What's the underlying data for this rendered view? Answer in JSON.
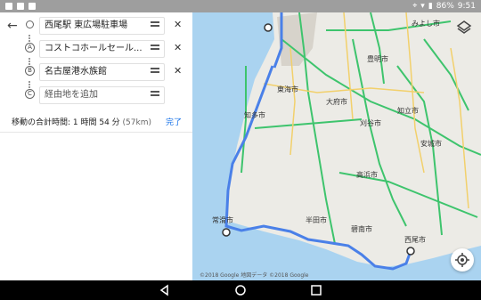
{
  "status_bar": {
    "time": "9:51",
    "battery": "86%"
  },
  "directions": {
    "stops": [
      {
        "label": "",
        "value": "西尾駅 東広場駐車場"
      },
      {
        "label": "A",
        "value": "コストコホールセール..."
      },
      {
        "label": "B",
        "value": "名古屋港水族館"
      },
      {
        "label": "C",
        "placeholder": "経由地を追加"
      }
    ],
    "summary_text": "移動の合計時間: 1 時間 54 分",
    "summary_distance": "(57km)",
    "done_label": "完了"
  },
  "map": {
    "labels": {
      "tokai": "東海市",
      "chita": "知多市",
      "obu": "大府市",
      "kariya": "刈谷市",
      "chiryu": "知立市",
      "toyoake": "豊明市",
      "miyoshi": "みよし市",
      "anjo": "安城市",
      "takahama": "高浜市",
      "hekinan": "碧南市",
      "handa": "半田市",
      "nishio": "西尾市",
      "tokoname": "常滑市",
      "copyright": "©2018 Google  地図データ ©2018 Google"
    },
    "colors": {
      "route": "#4a80e8",
      "water": "#aad3f0",
      "land": "#ecebe6",
      "highway": "#3ec46d"
    }
  }
}
